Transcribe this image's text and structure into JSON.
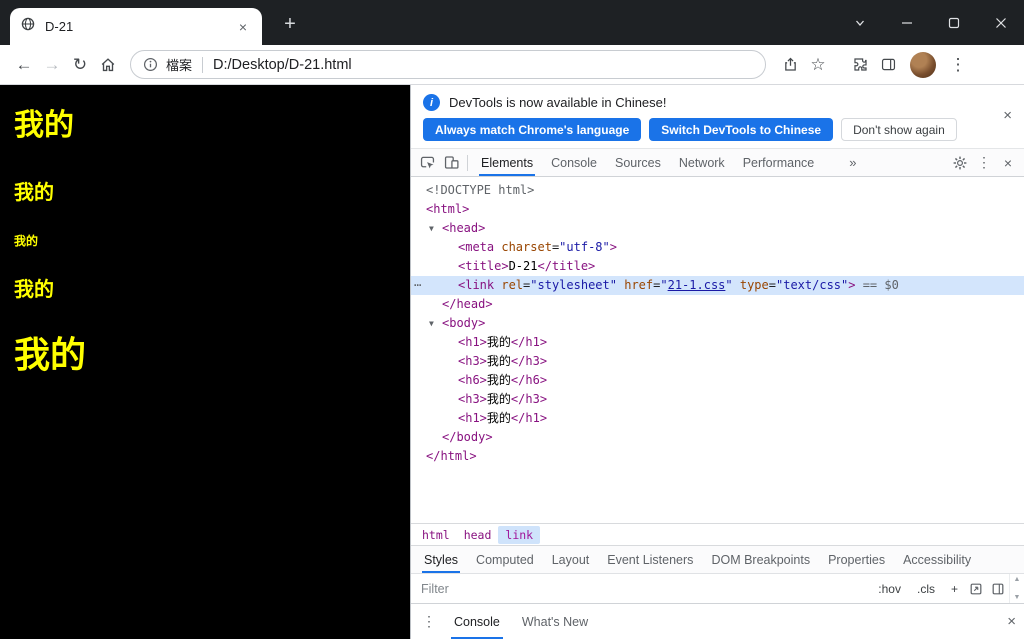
{
  "colors": {
    "accent_blue": "#1a73e8",
    "page_bg": "#000000",
    "page_fg": "#ffff00",
    "tag": "#881280",
    "attr_name": "#994500",
    "attr_value": "#1a1aa6",
    "selected_row_bg": "#d3e5fc"
  },
  "icons": {
    "back": "←",
    "forward": "→",
    "reload": "↻",
    "star": "☆",
    "kebab": "⋮",
    "close": "×",
    "new_tab": "+",
    "more_tabs": "»",
    "tree_arrow": "▼",
    "overflow": "⋯",
    "info": "i",
    "scroll_up": "▲",
    "scroll_down": "▼"
  },
  "titlebar": {
    "tab_title": "D-21"
  },
  "toolbar": {
    "url_chip_label": "檔案",
    "url": "D:/Desktop/D-21.html"
  },
  "page": {
    "headings": [
      {
        "tag": "h1",
        "text": "我的",
        "size": 30
      },
      {
        "tag": "h3",
        "text": "我的",
        "size": 20
      },
      {
        "tag": "h6",
        "text": "我的",
        "size": 12
      },
      {
        "tag": "h3",
        "text": "我的",
        "size": 20
      },
      {
        "tag": "h1",
        "text": "我的",
        "size": 36
      }
    ]
  },
  "devtools": {
    "banner": {
      "message": "DevTools is now available in Chinese!",
      "buttons": [
        {
          "label": "Always match Chrome's language",
          "style": "primary"
        },
        {
          "label": "Switch DevTools to Chinese",
          "style": "primary"
        },
        {
          "label": "Don't show again",
          "style": "secondary"
        }
      ]
    },
    "tabs": [
      "Elements",
      "Console",
      "Sources",
      "Network",
      "Performance"
    ],
    "active_tab": "Elements",
    "tree": [
      {
        "i": 0,
        "tok": [
          {
            "c": "doctype",
            "t": "<!DOCTYPE html>"
          }
        ]
      },
      {
        "i": 0,
        "tok": [
          {
            "c": "tag",
            "t": "<html>"
          }
        ]
      },
      {
        "i": 1,
        "a": 1,
        "tok": [
          {
            "c": "tag",
            "t": "<head>"
          }
        ]
      },
      {
        "i": 2,
        "tok": [
          {
            "c": "tag",
            "t": "<meta"
          },
          {
            "c": "plain",
            "t": " "
          },
          {
            "c": "attr",
            "t": "charset"
          },
          {
            "c": "plain",
            "t": "="
          },
          {
            "c": "val",
            "t": "\"utf-8\""
          },
          {
            "c": "tag",
            "t": ">"
          }
        ]
      },
      {
        "i": 2,
        "tok": [
          {
            "c": "tag",
            "t": "<title>"
          },
          {
            "c": "text",
            "t": "D-21"
          },
          {
            "c": "tag",
            "t": "</title>"
          }
        ]
      },
      {
        "i": 2,
        "sel": 1,
        "gut": "⋯",
        "tok": [
          {
            "c": "tag",
            "t": "<link"
          },
          {
            "c": "plain",
            "t": " "
          },
          {
            "c": "attr",
            "t": "rel"
          },
          {
            "c": "plain",
            "t": "="
          },
          {
            "c": "val",
            "t": "\"stylesheet\""
          },
          {
            "c": "plain",
            "t": " "
          },
          {
            "c": "attr",
            "t": "href"
          },
          {
            "c": "plain",
            "t": "="
          },
          {
            "c": "val",
            "t": "\""
          },
          {
            "c": "link",
            "t": "21-1.css"
          },
          {
            "c": "val",
            "t": "\""
          },
          {
            "c": "plain",
            "t": " "
          },
          {
            "c": "attr",
            "t": "type"
          },
          {
            "c": "plain",
            "t": "="
          },
          {
            "c": "val",
            "t": "\"text/css\""
          },
          {
            "c": "tag",
            "t": ">"
          },
          {
            "c": "marker",
            "t": " == $0"
          }
        ]
      },
      {
        "i": 1,
        "tok": [
          {
            "c": "tag",
            "t": "</head>"
          }
        ]
      },
      {
        "i": 1,
        "a": 1,
        "tok": [
          {
            "c": "tag",
            "t": "<body>"
          }
        ]
      },
      {
        "i": 2,
        "tok": [
          {
            "c": "tag",
            "t": "<h1>"
          },
          {
            "c": "text",
            "t": "我的"
          },
          {
            "c": "tag",
            "t": "</h1>"
          }
        ]
      },
      {
        "i": 2,
        "tok": [
          {
            "c": "tag",
            "t": "<h3>"
          },
          {
            "c": "text",
            "t": "我的"
          },
          {
            "c": "tag",
            "t": "</h3>"
          }
        ]
      },
      {
        "i": 2,
        "tok": [
          {
            "c": "tag",
            "t": "<h6>"
          },
          {
            "c": "text",
            "t": "我的"
          },
          {
            "c": "tag",
            "t": "</h6>"
          }
        ]
      },
      {
        "i": 2,
        "tok": [
          {
            "c": "tag",
            "t": "<h3>"
          },
          {
            "c": "text",
            "t": "我的"
          },
          {
            "c": "tag",
            "t": "</h3>"
          }
        ]
      },
      {
        "i": 2,
        "tok": [
          {
            "c": "tag",
            "t": "<h1>"
          },
          {
            "c": "text",
            "t": "我的"
          },
          {
            "c": "tag",
            "t": "</h1>"
          }
        ]
      },
      {
        "i": 1,
        "tok": [
          {
            "c": "tag",
            "t": "</body>"
          }
        ]
      },
      {
        "i": 0,
        "tok": [
          {
            "c": "tag",
            "t": "</html>"
          }
        ]
      }
    ],
    "breadcrumbs": [
      {
        "label": "html"
      },
      {
        "label": "head"
      },
      {
        "label": "link",
        "selected": true
      }
    ],
    "sidebar_tabs": [
      "Styles",
      "Computed",
      "Layout",
      "Event Listeners",
      "DOM Breakpoints",
      "Properties",
      "Accessibility"
    ],
    "active_sidebar_tab": "Styles",
    "filter": {
      "placeholder": "Filter",
      "actions": [
        ":hov",
        ".cls",
        "+"
      ]
    },
    "drawer": {
      "tabs": [
        "Console",
        "What's New"
      ],
      "active": "Console"
    }
  }
}
